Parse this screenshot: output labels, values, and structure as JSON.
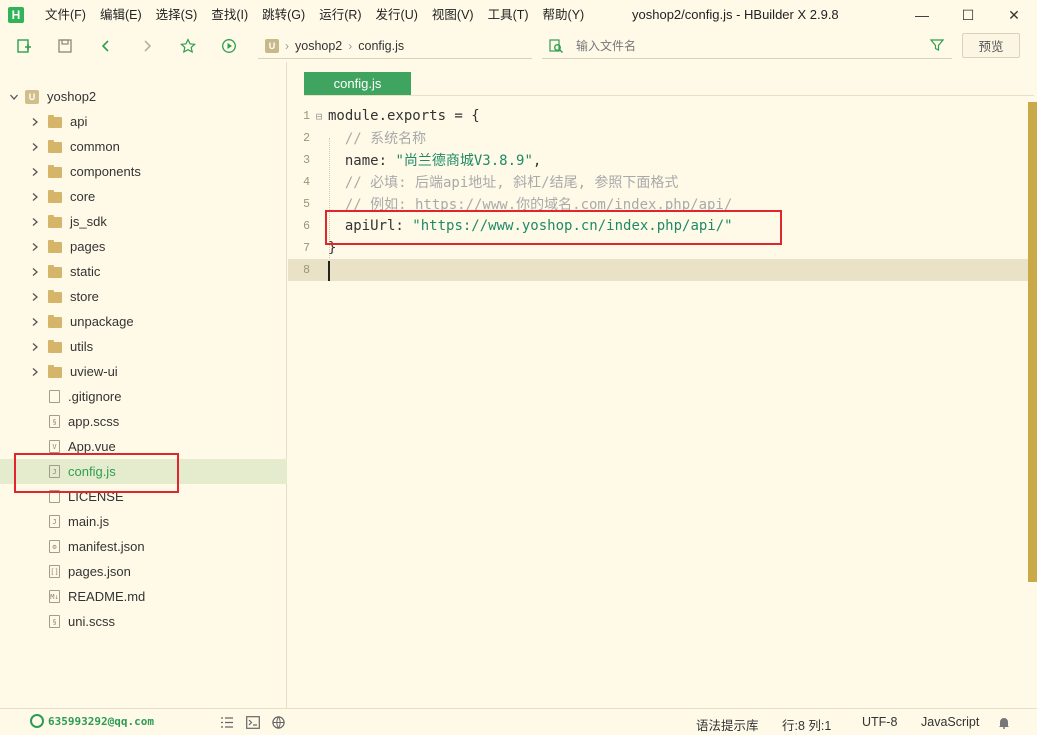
{
  "app": {
    "logo_letter": "H",
    "window_title": "yoshop2/config.js - HBuilder X 2.9.8",
    "menu": [
      "文件(F)",
      "编辑(E)",
      "选择(S)",
      "查找(I)",
      "跳转(G)",
      "运行(R)",
      "发行(U)",
      "视图(V)",
      "工具(T)",
      "帮助(Y)"
    ],
    "controls": {
      "minimize": "—",
      "maximize": "☐",
      "close": "✕"
    }
  },
  "toolbar": {
    "icons": [
      "new-file-icon",
      "save-icon",
      "back-icon",
      "forward-icon",
      "star-icon",
      "run-icon"
    ],
    "breadcrumb": {
      "project_badge": "U",
      "project": "yoshop2",
      "file": "config.js",
      "separator": "›"
    },
    "file_search_placeholder": "输入文件名",
    "preview_label": "预览"
  },
  "sidebar": {
    "project": {
      "label": "yoshop2",
      "badge": "U"
    },
    "folders": [
      "api",
      "common",
      "components",
      "core",
      "js_sdk",
      "pages",
      "static",
      "store",
      "unpackage",
      "utils",
      "uview-ui"
    ],
    "files": [
      {
        "label": ".gitignore",
        "glyph": ""
      },
      {
        "label": "app.scss",
        "glyph": "§"
      },
      {
        "label": "App.vue",
        "glyph": "V"
      },
      {
        "label": "config.js",
        "glyph": "J",
        "selected": true
      },
      {
        "label": "LICENSE",
        "glyph": ""
      },
      {
        "label": "main.js",
        "glyph": "J"
      },
      {
        "label": "manifest.json",
        "glyph": "⚙"
      },
      {
        "label": "pages.json",
        "glyph": "[]"
      },
      {
        "label": "README.md",
        "glyph": "M↓"
      },
      {
        "label": "uni.scss",
        "glyph": "§"
      }
    ]
  },
  "editor": {
    "tab_label": "config.js",
    "lines": [
      {
        "n": "1",
        "fold": "⊟",
        "parts": [
          [
            "c-key",
            "module.exports = {"
          ]
        ]
      },
      {
        "n": "2",
        "fold": "",
        "parts": [
          [
            "c-comment",
            "  // 系统名称"
          ]
        ]
      },
      {
        "n": "3",
        "fold": "",
        "parts": [
          [
            "c-key",
            "  name: "
          ],
          [
            "c-str",
            "\"尚兰德商城V3.8.9\""
          ],
          [
            "c-punct",
            ","
          ]
        ]
      },
      {
        "n": "4",
        "fold": "",
        "parts": [
          [
            "c-comment",
            "  // 必填: 后端api地址, 斜杠/结尾, 参照下面格式"
          ]
        ]
      },
      {
        "n": "5",
        "fold": "",
        "parts": [
          [
            "c-comment",
            "  // 例如: https://www.你的域名.com/index.php/api/"
          ]
        ]
      },
      {
        "n": "6",
        "fold": "",
        "parts": [
          [
            "c-key",
            "  apiUrl: "
          ],
          [
            "c-str",
            "\"https://www.yoshop.cn/index.php/api/\""
          ]
        ]
      },
      {
        "n": "7",
        "fold": "",
        "parts": [
          [
            "c-key",
            "}"
          ]
        ]
      },
      {
        "n": "8",
        "fold": "",
        "parts": [
          [
            "c-key",
            ""
          ]
        ]
      }
    ]
  },
  "status": {
    "account": "635993292@qq.com",
    "syntax_hint": "语法提示库",
    "position": "行:8  列:1",
    "encoding": "UTF-8",
    "language": "JavaScript"
  }
}
